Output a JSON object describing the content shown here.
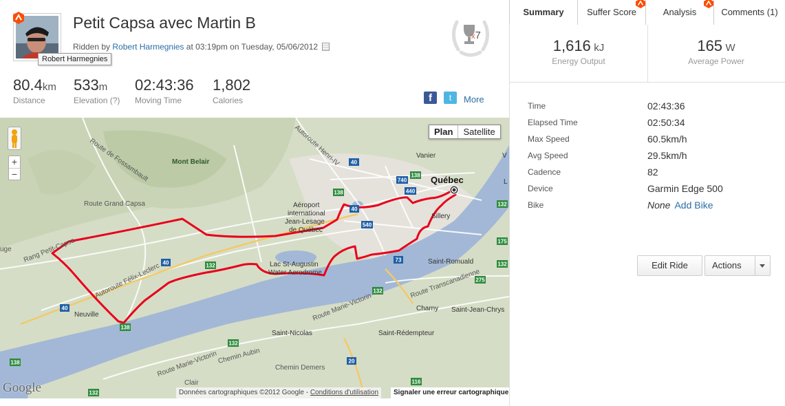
{
  "activity": {
    "title": "Petit Capsa avec Martin B",
    "ridden_prefix": "Ridden by",
    "athlete": "Robert Harmegnies",
    "ridden_suffix": "at 03:19pm on Tuesday, 05/06/2012",
    "avatar_tooltip": "Robert Harmegnies",
    "trophy_multiplier": "x",
    "trophy_count": "7"
  },
  "stats": [
    {
      "value": "80.4",
      "unit": "km",
      "label": "Distance"
    },
    {
      "value": "533",
      "unit": "m",
      "label": "Elevation (?)"
    },
    {
      "value": "02:43:36",
      "unit": "",
      "label": "Moving Time"
    },
    {
      "value": "1,802",
      "unit": "",
      "label": "Calories"
    }
  ],
  "share": {
    "facebook": "f",
    "twitter": "t",
    "more": "More"
  },
  "map": {
    "view_plan": "Plan",
    "view_satellite": "Satellite",
    "zoom_in": "+",
    "zoom_out": "−",
    "logo": "Google",
    "footer_text": "Données cartographiques ©2012 Google -",
    "footer_link": "Conditions d'utilisation",
    "report": "Signaler une erreur cartographique",
    "labels": {
      "mont_belair": "Mont Belair",
      "route_fossambault": "Route de Fossambault",
      "autoroute_henri": "Autoroute Henri-IV",
      "route_grand_capsa": "Route Grand Capsa",
      "rang_petit_capsa": "Rang Petit-Capsa",
      "autoroute_felix": "Autoroute Félix-Leclerc",
      "neuville": "Neuville",
      "aeroport": "Aéroport",
      "international": "international",
      "jean_lesage": "Jean-Lesage",
      "de_quebec": "de Québec",
      "lac_st_augustin": "Lac St-Augustin",
      "water_aerodrome": "Water Aerodrome",
      "quebec": "Québec",
      "vanier": "Vanier",
      "sillery": "Sillery",
      "saint_romuald": "Saint-Romuald",
      "route_transcanadienne": "Route Transcanadienne",
      "saint_jean_chrys": "Saint-Jean-Chrys",
      "charny": "Charny",
      "route_marie_victorin": "Route Marie-Victorin",
      "saint_nicolas": "Saint-Nicolas",
      "saint_redempteur": "Saint-Rédempteur",
      "chemin_aubin": "Chemin Aubin",
      "chemin_demers": "Chemin Demers",
      "route_marie_victorin_2": "Route Marie-Victorin",
      "clair": "Clair",
      "uge": "uge",
      "l": "L",
      "v": "V"
    },
    "shields": [
      "40",
      "740",
      "138",
      "440",
      "540",
      "138",
      "40",
      "138",
      "40",
      "73",
      "132",
      "132",
      "132",
      "20",
      "116",
      "275",
      "132",
      "138",
      "132",
      "175",
      "132",
      "138",
      "40"
    ]
  },
  "tabs": [
    {
      "label": "Summary",
      "active": true
    },
    {
      "label": "Suffer Score",
      "active": false
    },
    {
      "label": "Analysis",
      "active": false
    },
    {
      "label": "Comments (1)",
      "active": false
    }
  ],
  "summary": {
    "energy": {
      "value": "1,616",
      "unit": "kJ",
      "label": "Energy Output"
    },
    "power": {
      "value": "165",
      "unit": "W",
      "label": "Average Power"
    }
  },
  "details": [
    {
      "key": "Time",
      "value": "02:43:36"
    },
    {
      "key": "Elapsed Time",
      "value": "02:50:34"
    },
    {
      "key": "Max Speed",
      "value": "60.5km/h"
    },
    {
      "key": "Avg Speed",
      "value": "29.5km/h"
    },
    {
      "key": "Cadence",
      "value": "82"
    },
    {
      "key": "Device",
      "value": "Garmin Edge 500"
    }
  ],
  "bike": {
    "key": "Bike",
    "value": "None",
    "link": "Add Bike"
  },
  "actions": {
    "edit": "Edit Ride",
    "actions": "Actions"
  },
  "colors": {
    "route": "#e8001c",
    "link": "#2a6ea6",
    "strava_orange": "#fc4c02",
    "water": "#a3b8d6",
    "land": "#d6ddc6"
  }
}
